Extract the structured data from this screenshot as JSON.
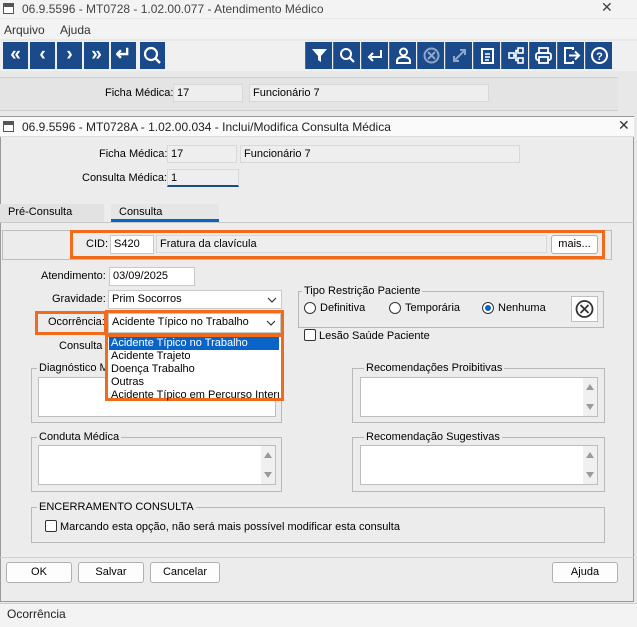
{
  "back_window": {
    "title": "06.9.5596 - MT0728 - 1.02.00.077 - Atendimento Médico",
    "menu": [
      "Arquivo",
      "Ajuda"
    ],
    "nav_buttons": [
      "«",
      "‹",
      "›",
      "»",
      "↵"
    ],
    "ficha_label": "Ficha Médica:",
    "ficha_value": "17",
    "ficha_name": "Funcionário 7"
  },
  "dialog": {
    "title": "06.9.5596 - MT0728A - 1.02.00.034 - Inclui/Modifica Consulta Médica",
    "ficha_label": "Ficha Médica:",
    "ficha_value": "17",
    "ficha_name": "Funcionário 7",
    "consulta_label": "Consulta Médica:",
    "consulta_value": "1",
    "tabs": [
      "Pré-Consulta",
      "Consulta"
    ],
    "active_tab": "Consulta",
    "cid_label": "CID:",
    "cid_code": "S420",
    "cid_desc": "Fratura da clavícula",
    "mais_label": "mais...",
    "atendimento_label": "Atendimento:",
    "atendimento_value": "03/09/2025",
    "gravidade_label": "Gravidade:",
    "gravidade_value": "Prim Socorros",
    "ocorrencia_label": "Ocorrência:",
    "ocorrencia_value": "Acidente Típico no Trabalho",
    "ocorrencia_options": [
      "Acidente Típico no Trabalho",
      "Acidente Trajeto",
      "Doença Trabalho",
      "Outras",
      "Acidente Típico em Percurso Interno"
    ],
    "consulta_cut_label": "Consulta",
    "diagnostico_label": "Diagnóstico M",
    "tipo_restricao_title": "Tipo Restrição Paciente",
    "radio_options": [
      "Definitiva",
      "Temporária",
      "Nenhuma"
    ],
    "radio_selected": "Nenhuma",
    "lesao_label": "Lesão Saúde Paciente",
    "recom_proibitivas_label": "Recomendações Proibitivas",
    "conduta_label": "Conduta Médica",
    "recom_sugestivas_label": "Recomendação Sugestivas",
    "encerramento_title": "ENCERRAMENTO CONSULTA",
    "encerramento_check_label": "Marcando esta opção, não será mais possível modificar esta consulta",
    "buttons": {
      "ok": "OK",
      "salvar": "Salvar",
      "cancelar": "Cancelar",
      "ajuda": "Ajuda"
    }
  },
  "status_bar": {
    "text": "Ocorrência"
  },
  "colors": {
    "toolbar_blue": "#1a4a8a",
    "highlight_orange": "#f26b1d",
    "selection_blue": "#0a64c8"
  }
}
